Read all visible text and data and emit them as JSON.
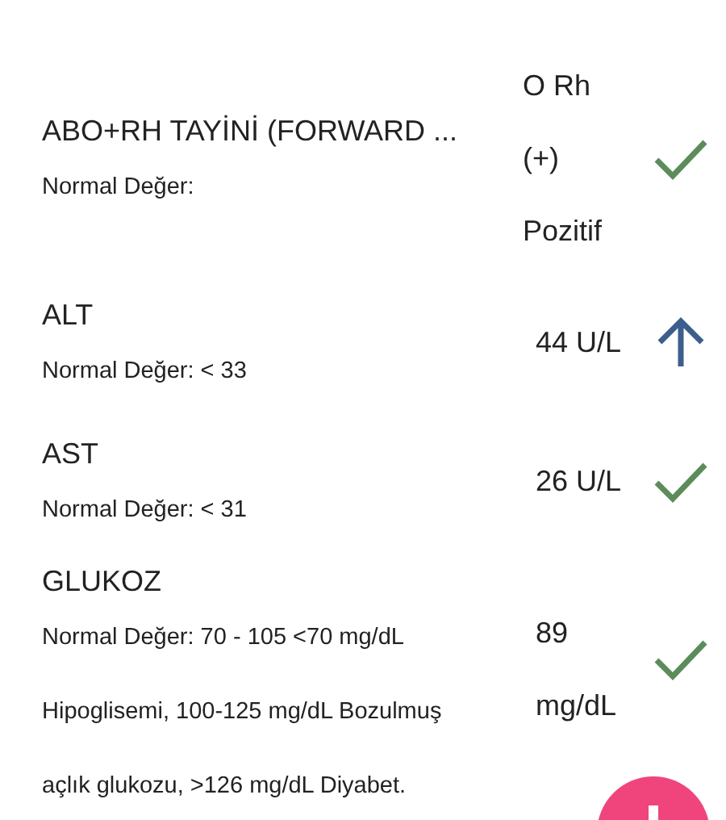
{
  "results": [
    {
      "name": "ABO+RH TAYİNİ (FORWARD ...",
      "normal_lines": [
        "Normal Değer:"
      ],
      "value_lines": [
        "O Rh",
        "(+)",
        "Pozitif"
      ],
      "kind": "check"
    },
    {
      "name": "ALT",
      "normal_lines": [
        "Normal Değer: < 33"
      ],
      "value_lines": [
        "44 U/L"
      ],
      "kind": "arrow"
    },
    {
      "name": "AST",
      "normal_lines": [
        "Normal Değer: < 31"
      ],
      "value_lines": [
        "26 U/L"
      ],
      "kind": "check"
    },
    {
      "name": "GLUKOZ",
      "normal_lines": [
        "Normal Değer: 70 - 105 <70 mg/dL",
        "Hipoglisemi, 100-125 mg/dL Bozulmuş",
        "açlık glukozu, >126 mg/dL Diyabet."
      ],
      "value_lines": [
        "89",
        "mg/dL"
      ],
      "kind": "check"
    }
  ]
}
